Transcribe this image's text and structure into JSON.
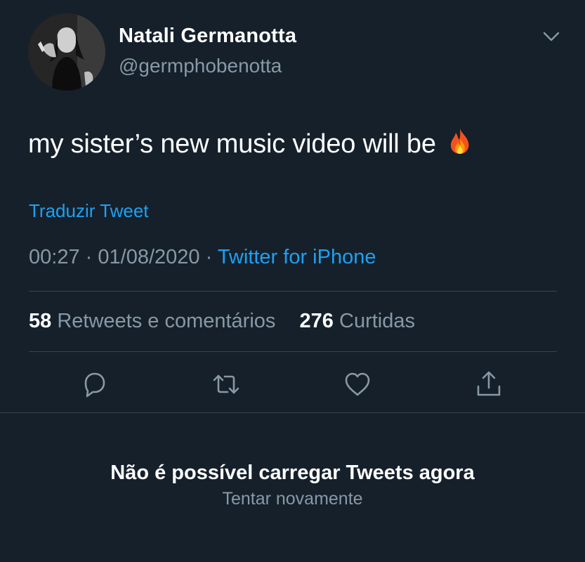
{
  "tweet": {
    "author": {
      "display_name": "Natali Germanotta",
      "handle": "@germphobenotta"
    },
    "text": "my sister’s new music video will be",
    "emoji_icon": "fire-icon",
    "translate_label": "Traduzir Tweet",
    "time": "00:27",
    "date": "01/08/2020",
    "separator": "·",
    "source": "Twitter for iPhone",
    "stats": {
      "retweets_count": "58",
      "retweets_label": "Retweets e comentários",
      "likes_count": "276",
      "likes_label": "Curtidas"
    },
    "actions": [
      "reply-icon",
      "retweet-icon",
      "like-icon",
      "share-icon"
    ]
  },
  "error": {
    "title": "Não é possível carregar Tweets agora",
    "retry_label": "Tentar novamente"
  },
  "colors": {
    "background": "#15202b",
    "link": "#1da1f2",
    "secondary_text": "#8899a6",
    "divider": "#38444d"
  }
}
